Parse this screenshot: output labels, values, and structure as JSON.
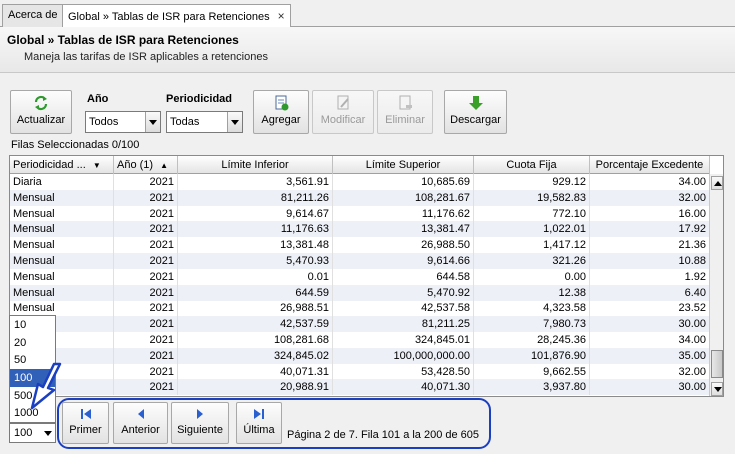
{
  "tabs": [
    {
      "label": "Acerca de"
    },
    {
      "label": "Global » Tablas de ISR para Retenciones",
      "close": "×"
    }
  ],
  "header": {
    "title": "Global » Tablas de ISR para Retenciones",
    "subtitle": "Maneja las tarifas de ISR aplicables a retenciones"
  },
  "toolbar": {
    "refresh_label": "Actualizar",
    "year_label": "Año",
    "year_value": "Todos",
    "period_label": "Periodicidad",
    "period_value": "Todas",
    "add_label": "Agregar",
    "edit_label": "Modificar",
    "delete_label": "Eliminar",
    "download_label": "Descargar"
  },
  "selection": {
    "text": "Filas Seleccionadas 0/100"
  },
  "grid": {
    "columns": [
      "Periodicidad ...",
      "Año (1)",
      "Límite Inferior",
      "Límite Superior",
      "Cuota Fija",
      "Porcentaje Excedente"
    ],
    "rows": [
      [
        "Diaria",
        "2021",
        "3,561.91",
        "10,685.69",
        "929.12",
        "34.00"
      ],
      [
        "Mensual",
        "2021",
        "81,211.26",
        "108,281.67",
        "19,582.83",
        "32.00"
      ],
      [
        "Mensual",
        "2021",
        "9,614.67",
        "11,176.62",
        "772.10",
        "16.00"
      ],
      [
        "Mensual",
        "2021",
        "11,176.63",
        "13,381.47",
        "1,022.01",
        "17.92"
      ],
      [
        "Mensual",
        "2021",
        "13,381.48",
        "26,988.50",
        "1,417.12",
        "21.36"
      ],
      [
        "Mensual",
        "2021",
        "5,470.93",
        "9,614.66",
        "321.26",
        "10.88"
      ],
      [
        "Mensual",
        "2021",
        "0.01",
        "644.58",
        "0.00",
        "1.92"
      ],
      [
        "Mensual",
        "2021",
        "644.59",
        "5,470.92",
        "12.38",
        "6.40"
      ],
      [
        "Mensual",
        "2021",
        "26,988.51",
        "42,537.58",
        "4,323.58",
        "23.52"
      ],
      [
        "",
        "2021",
        "42,537.59",
        "81,211.25",
        "7,980.73",
        "30.00"
      ],
      [
        "",
        "2021",
        "108,281.68",
        "324,845.01",
        "28,245.36",
        "34.00"
      ],
      [
        "",
        "2021",
        "324,845.02",
        "100,000,000.00",
        "101,876.90",
        "35.00"
      ],
      [
        "",
        "2021",
        "40,071.31",
        "53,428.50",
        "9,662.55",
        "32.00"
      ],
      [
        "",
        "2021",
        "20,988.91",
        "40,071.30",
        "3,937.80",
        "30.00"
      ]
    ]
  },
  "page_size": {
    "options": [
      "10",
      "20",
      "50",
      "100",
      "500",
      "1000"
    ],
    "selected": "100"
  },
  "pager": {
    "first_label": "Primer",
    "prev_label": "Anterior",
    "next_label": "Siguiente",
    "last_label": "Última",
    "info": "Página 2 de 7. Fila 101 a la 200 de 605"
  },
  "colors": {
    "accent": "#1a3fc0",
    "selected_row": "#3060b8",
    "refresh_icon": "#2e9a2e",
    "download_icon": "#3aa02a"
  }
}
